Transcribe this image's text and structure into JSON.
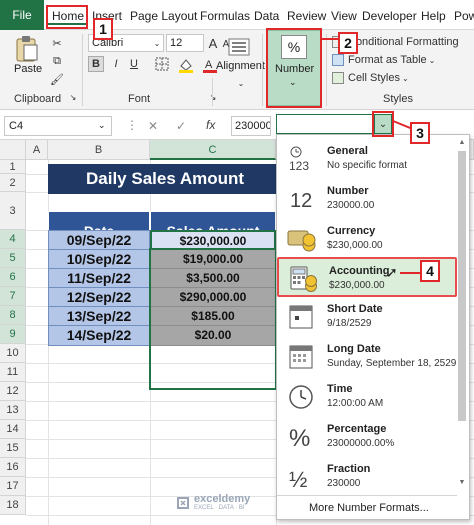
{
  "menu": {
    "file": "File",
    "home": "Home",
    "insert": "Insert",
    "page_layout": "Page Layout",
    "formulas": "Formulas",
    "data": "Data",
    "review": "Review",
    "view": "View",
    "developer": "Developer",
    "help": "Help",
    "power": "Pow"
  },
  "ribbon": {
    "paste": "Paste",
    "clipboard": "Clipboard",
    "font_name": "Calibri",
    "font_size": "12",
    "bold": "B",
    "italic": "I",
    "underline": "U",
    "font_group": "Font",
    "alignment": "Alignment",
    "number_symbol": "%",
    "number": "Number",
    "conditional_formatting": "Conditional Formatting",
    "format_as_table": "Format as Table",
    "cell_styles": "Cell Styles",
    "styles_group": "Styles",
    "grow_font": "A",
    "shrink_font": "A"
  },
  "formula_bar": {
    "name_box": "C4",
    "cancel": "✕",
    "enter": "✓",
    "fx": "fx",
    "value": "230000"
  },
  "sheet": {
    "columns": [
      "A",
      "B",
      "C"
    ],
    "rows": [
      "1",
      "2",
      "3",
      "4",
      "5",
      "6",
      "7",
      "8",
      "9",
      "10",
      "11",
      "12",
      "13",
      "14",
      "15",
      "16",
      "17",
      "18"
    ],
    "title": "Daily Sales Amount",
    "header_date": "Date",
    "header_amount": "Sales Amount",
    "records": [
      {
        "date": "09/Sep/22",
        "amount": "$230,000.00"
      },
      {
        "date": "10/Sep/22",
        "amount": "$19,000.00"
      },
      {
        "date": "11/Sep/22",
        "amount": "$3,500.00"
      },
      {
        "date": "12/Sep/22",
        "amount": "$290,000.00"
      },
      {
        "date": "13/Sep/22",
        "amount": "$185.00"
      },
      {
        "date": "14/Sep/22",
        "amount": "$20.00"
      }
    ]
  },
  "number_formats": [
    {
      "icon": "clock-123-icon",
      "name": "General",
      "example": "No specific format"
    },
    {
      "icon": "number-12-icon",
      "name": "Number",
      "example": "230000.00"
    },
    {
      "icon": "currency-icon",
      "name": "Currency",
      "example": "$230,000.00"
    },
    {
      "icon": "accounting-icon",
      "name": "Accounting",
      "example": "$230,000.00"
    },
    {
      "icon": "short-date-icon",
      "name": "Short Date",
      "example": "9/18/2529"
    },
    {
      "icon": "long-date-icon",
      "name": "Long Date",
      "example": "Sunday, September 18, 2529"
    },
    {
      "icon": "clock-icon",
      "name": "Time",
      "example": "12:00:00 AM"
    },
    {
      "icon": "percent-icon",
      "name": "Percentage",
      "example": "23000000.00%"
    },
    {
      "icon": "fraction-icon",
      "name": "Fraction",
      "example": "230000"
    }
  ],
  "more_formats": "More Number Formats...",
  "annotations": [
    "1",
    "2",
    "3",
    "4"
  ],
  "watermark": {
    "name": "exceldemy",
    "tagline": "EXCEL · DATA · BI"
  },
  "colors": {
    "excel_green": "#217346",
    "title_fill": "#1f3864",
    "header_fill": "#2f5597",
    "date_fill": "#b4c6e7",
    "amount_fill": "#a6a6a6",
    "annotation_red": "#e0282a"
  }
}
